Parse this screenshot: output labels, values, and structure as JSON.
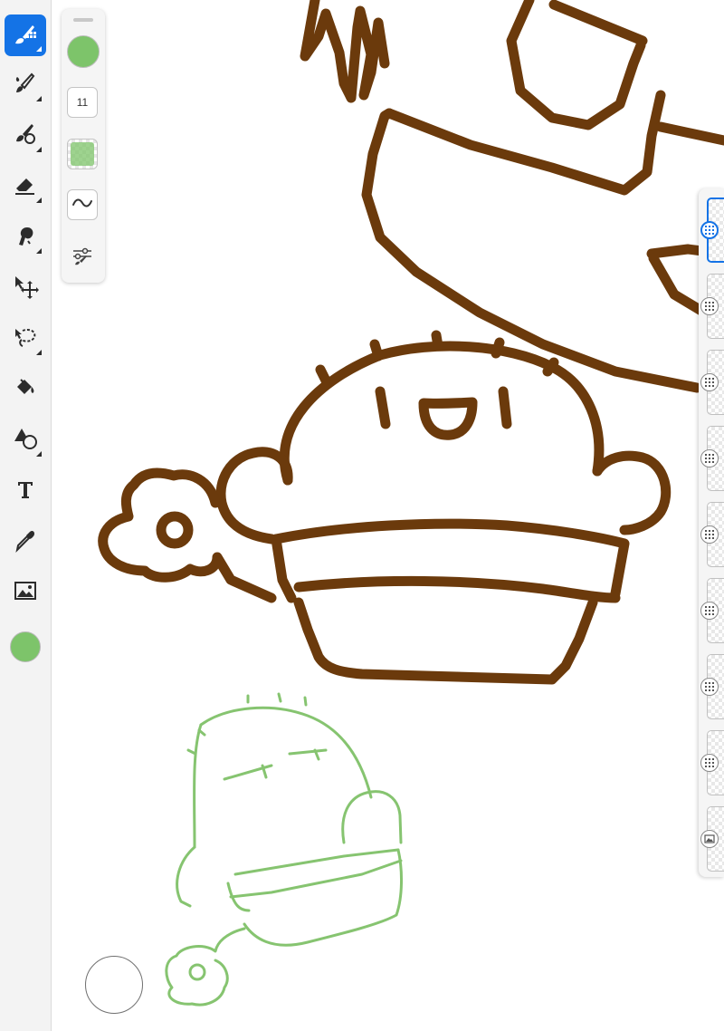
{
  "colors": {
    "accent": "#1473e6",
    "current_color": "#7dc46a",
    "ink": "#6b3a0c",
    "sketch": "#86c470"
  },
  "toolbar": {
    "tools": [
      {
        "name": "pixel-brush",
        "icon": "pixel-brush-icon",
        "active": true
      },
      {
        "name": "live-brush",
        "icon": "paint-brush-icon",
        "active": false
      },
      {
        "name": "vector-brush",
        "icon": "vector-brush-icon",
        "active": false
      },
      {
        "name": "eraser",
        "icon": "eraser-icon",
        "active": false
      },
      {
        "name": "smudge",
        "icon": "smudge-icon",
        "active": false
      },
      {
        "name": "transform",
        "icon": "move-icon",
        "active": false
      },
      {
        "name": "selection",
        "icon": "lasso-icon",
        "active": false
      },
      {
        "name": "fill",
        "icon": "paint-bucket-icon",
        "active": false
      },
      {
        "name": "shapes",
        "icon": "shapes-icon",
        "active": false
      },
      {
        "name": "text",
        "icon": "text-icon",
        "active": false
      },
      {
        "name": "eyedropper",
        "icon": "eyedropper-icon",
        "active": false
      },
      {
        "name": "place-image",
        "icon": "image-icon",
        "active": false
      }
    ]
  },
  "brush_properties": {
    "size": "11",
    "smoothing_icon": "smoothing-wave-icon",
    "settings_icon": "brush-settings-icon"
  },
  "layers": {
    "selected_index": 0,
    "items": [
      {
        "type": "pixel",
        "icon": "pixel-layer-icon"
      },
      {
        "type": "pixel",
        "icon": "pixel-layer-icon"
      },
      {
        "type": "pixel",
        "icon": "pixel-layer-icon"
      },
      {
        "type": "pixel",
        "icon": "pixel-layer-icon"
      },
      {
        "type": "pixel",
        "icon": "pixel-layer-icon"
      },
      {
        "type": "pixel",
        "icon": "pixel-layer-icon"
      },
      {
        "type": "pixel",
        "icon": "pixel-layer-icon"
      },
      {
        "type": "pixel",
        "icon": "pixel-layer-icon"
      },
      {
        "type": "image",
        "icon": "image-layer-icon"
      }
    ]
  }
}
